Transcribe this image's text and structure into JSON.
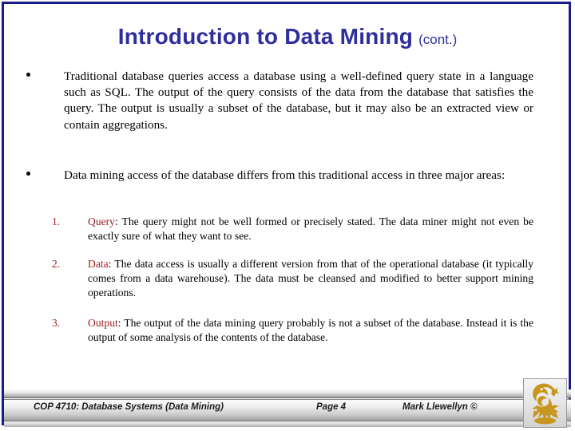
{
  "slide": {
    "title": {
      "main": "Introduction to Data Mining",
      "cont": "(cont.)",
      "color": "#2e2e9c"
    },
    "bullets": [
      {
        "marker": "•",
        "text": "Traditional database queries access a database using a well-defined query state in a language such as SQL.  The output of the query consists of the data from the database that satisfies the query.  The output is usually a subset of the database, but it may also be an extracted view or contain aggregations."
      },
      {
        "marker": "•",
        "text": "Data mining access of the database differs from this traditional access in three major areas:"
      }
    ],
    "numbered_items": [
      {
        "number": "1.",
        "keyword": "Query",
        "separator": ":",
        "text": "  The query might not be well formed or precisely stated.  The data miner might not even be exactly sure of what they want to see.",
        "keyword_color": "#9d1f28"
      },
      {
        "number": "2.",
        "keyword": "Data",
        "separator": ":",
        "text": " The data access is usually a different version from that of the operational database (it typically comes from a data warehouse).  The data must be cleansed and modified to better support mining operations.",
        "keyword_color": "#9d1f28"
      },
      {
        "number": "3.",
        "keyword": "Output",
        "separator": ":",
        "text": "  The output of the data mining query probably is not a subset of the database.  Instead it is the output of some analysis of the contents of the database.",
        "keyword_color": "#9d1f28"
      }
    ],
    "footer": {
      "course": "COP 4710: Database Systems  (Data Mining)",
      "page": "Page 4",
      "author": "Mark Llewellyn ©"
    },
    "logo": {
      "name": "ucf-pegasus-logo",
      "color": "#c8961e"
    },
    "border_color": "#1a1a8c"
  }
}
